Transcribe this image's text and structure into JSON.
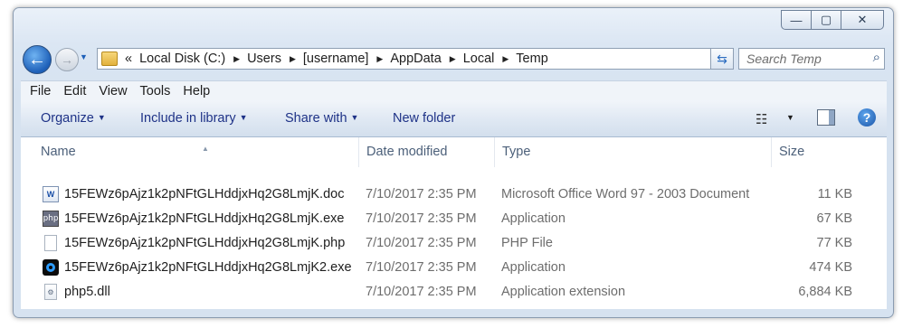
{
  "window": {
    "minimize_label": "—",
    "maximize_label": "▢",
    "close_label": "✕"
  },
  "nav": {
    "back_glyph": "←",
    "forward_glyph": "→",
    "history_glyph": "▼"
  },
  "address": {
    "overflow": "«",
    "crumbs": [
      "Local Disk (C:)",
      "Users",
      "[username]",
      "AppData",
      "Local",
      "Temp"
    ],
    "separator": "▶",
    "dropdown_glyph": "▼",
    "refresh_glyph": "⇆"
  },
  "search": {
    "placeholder": "Search Temp",
    "icon": "⌕"
  },
  "menu": [
    "File",
    "Edit",
    "View",
    "Tools",
    "Help"
  ],
  "commands": {
    "organize": "Organize",
    "include": "Include in library",
    "share": "Share with",
    "new_folder": "New folder",
    "caret": "▼",
    "view_glyph": "☷",
    "help_glyph": "?"
  },
  "columns": {
    "name": "Name",
    "date": "Date modified",
    "type": "Type",
    "size": "Size",
    "sort_glyph": "▲"
  },
  "files": [
    {
      "icon": "word-doc-icon",
      "name": "15FEWz6pAjz1k2pNFtGLHddjxHq2G8LmjK.doc",
      "date": "7/10/2017 2:35 PM",
      "type": "Microsoft Office Word 97 - 2003 Document",
      "size": "11 KB",
      "icon_text": "W"
    },
    {
      "icon": "php-exe-icon",
      "name": "15FEWz6pAjz1k2pNFtGLHddjxHq2G8LmjK.exe",
      "date": "7/10/2017 2:35 PM",
      "type": "Application",
      "size": "67 KB",
      "icon_text": "php"
    },
    {
      "icon": "blank-file-icon",
      "name": "15FEWz6pAjz1k2pNFtGLHddjxHq2G8LmjK.php",
      "date": "7/10/2017 2:35 PM",
      "type": "PHP File",
      "size": "77 KB",
      "icon_text": ""
    },
    {
      "icon": "eye-app-icon",
      "name": "15FEWz6pAjz1k2pNFtGLHddjxHq2G8LmjK2.exe",
      "date": "7/10/2017 2:35 PM",
      "type": "Application",
      "size": "474 KB",
      "icon_text": ""
    },
    {
      "icon": "dll-file-icon",
      "name": "php5.dll",
      "date": "7/10/2017 2:35 PM",
      "type": "Application extension",
      "size": "6,884 KB",
      "icon_text": "⚙"
    }
  ],
  "colors": {
    "accent": "#1e3287",
    "header_text": "#4c607a",
    "meta_text": "#6d6d6d"
  }
}
